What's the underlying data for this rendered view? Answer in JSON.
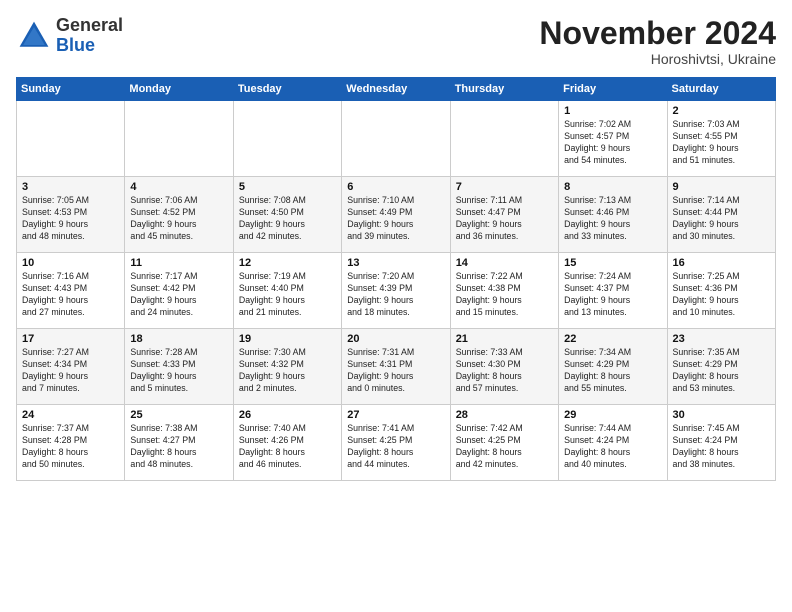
{
  "header": {
    "logo_general": "General",
    "logo_blue": "Blue",
    "month_title": "November 2024",
    "location": "Horoshivtsi, Ukraine"
  },
  "days_of_week": [
    "Sunday",
    "Monday",
    "Tuesday",
    "Wednesday",
    "Thursday",
    "Friday",
    "Saturday"
  ],
  "weeks": [
    [
      {
        "day": "",
        "info": ""
      },
      {
        "day": "",
        "info": ""
      },
      {
        "day": "",
        "info": ""
      },
      {
        "day": "",
        "info": ""
      },
      {
        "day": "",
        "info": ""
      },
      {
        "day": "1",
        "info": "Sunrise: 7:02 AM\nSunset: 4:57 PM\nDaylight: 9 hours\nand 54 minutes."
      },
      {
        "day": "2",
        "info": "Sunrise: 7:03 AM\nSunset: 4:55 PM\nDaylight: 9 hours\nand 51 minutes."
      }
    ],
    [
      {
        "day": "3",
        "info": "Sunrise: 7:05 AM\nSunset: 4:53 PM\nDaylight: 9 hours\nand 48 minutes."
      },
      {
        "day": "4",
        "info": "Sunrise: 7:06 AM\nSunset: 4:52 PM\nDaylight: 9 hours\nand 45 minutes."
      },
      {
        "day": "5",
        "info": "Sunrise: 7:08 AM\nSunset: 4:50 PM\nDaylight: 9 hours\nand 42 minutes."
      },
      {
        "day": "6",
        "info": "Sunrise: 7:10 AM\nSunset: 4:49 PM\nDaylight: 9 hours\nand 39 minutes."
      },
      {
        "day": "7",
        "info": "Sunrise: 7:11 AM\nSunset: 4:47 PM\nDaylight: 9 hours\nand 36 minutes."
      },
      {
        "day": "8",
        "info": "Sunrise: 7:13 AM\nSunset: 4:46 PM\nDaylight: 9 hours\nand 33 minutes."
      },
      {
        "day": "9",
        "info": "Sunrise: 7:14 AM\nSunset: 4:44 PM\nDaylight: 9 hours\nand 30 minutes."
      }
    ],
    [
      {
        "day": "10",
        "info": "Sunrise: 7:16 AM\nSunset: 4:43 PM\nDaylight: 9 hours\nand 27 minutes."
      },
      {
        "day": "11",
        "info": "Sunrise: 7:17 AM\nSunset: 4:42 PM\nDaylight: 9 hours\nand 24 minutes."
      },
      {
        "day": "12",
        "info": "Sunrise: 7:19 AM\nSunset: 4:40 PM\nDaylight: 9 hours\nand 21 minutes."
      },
      {
        "day": "13",
        "info": "Sunrise: 7:20 AM\nSunset: 4:39 PM\nDaylight: 9 hours\nand 18 minutes."
      },
      {
        "day": "14",
        "info": "Sunrise: 7:22 AM\nSunset: 4:38 PM\nDaylight: 9 hours\nand 15 minutes."
      },
      {
        "day": "15",
        "info": "Sunrise: 7:24 AM\nSunset: 4:37 PM\nDaylight: 9 hours\nand 13 minutes."
      },
      {
        "day": "16",
        "info": "Sunrise: 7:25 AM\nSunset: 4:36 PM\nDaylight: 9 hours\nand 10 minutes."
      }
    ],
    [
      {
        "day": "17",
        "info": "Sunrise: 7:27 AM\nSunset: 4:34 PM\nDaylight: 9 hours\nand 7 minutes."
      },
      {
        "day": "18",
        "info": "Sunrise: 7:28 AM\nSunset: 4:33 PM\nDaylight: 9 hours\nand 5 minutes."
      },
      {
        "day": "19",
        "info": "Sunrise: 7:30 AM\nSunset: 4:32 PM\nDaylight: 9 hours\nand 2 minutes."
      },
      {
        "day": "20",
        "info": "Sunrise: 7:31 AM\nSunset: 4:31 PM\nDaylight: 9 hours\nand 0 minutes."
      },
      {
        "day": "21",
        "info": "Sunrise: 7:33 AM\nSunset: 4:30 PM\nDaylight: 8 hours\nand 57 minutes."
      },
      {
        "day": "22",
        "info": "Sunrise: 7:34 AM\nSunset: 4:29 PM\nDaylight: 8 hours\nand 55 minutes."
      },
      {
        "day": "23",
        "info": "Sunrise: 7:35 AM\nSunset: 4:29 PM\nDaylight: 8 hours\nand 53 minutes."
      }
    ],
    [
      {
        "day": "24",
        "info": "Sunrise: 7:37 AM\nSunset: 4:28 PM\nDaylight: 8 hours\nand 50 minutes."
      },
      {
        "day": "25",
        "info": "Sunrise: 7:38 AM\nSunset: 4:27 PM\nDaylight: 8 hours\nand 48 minutes."
      },
      {
        "day": "26",
        "info": "Sunrise: 7:40 AM\nSunset: 4:26 PM\nDaylight: 8 hours\nand 46 minutes."
      },
      {
        "day": "27",
        "info": "Sunrise: 7:41 AM\nSunset: 4:25 PM\nDaylight: 8 hours\nand 44 minutes."
      },
      {
        "day": "28",
        "info": "Sunrise: 7:42 AM\nSunset: 4:25 PM\nDaylight: 8 hours\nand 42 minutes."
      },
      {
        "day": "29",
        "info": "Sunrise: 7:44 AM\nSunset: 4:24 PM\nDaylight: 8 hours\nand 40 minutes."
      },
      {
        "day": "30",
        "info": "Sunrise: 7:45 AM\nSunset: 4:24 PM\nDaylight: 8 hours\nand 38 minutes."
      }
    ]
  ]
}
